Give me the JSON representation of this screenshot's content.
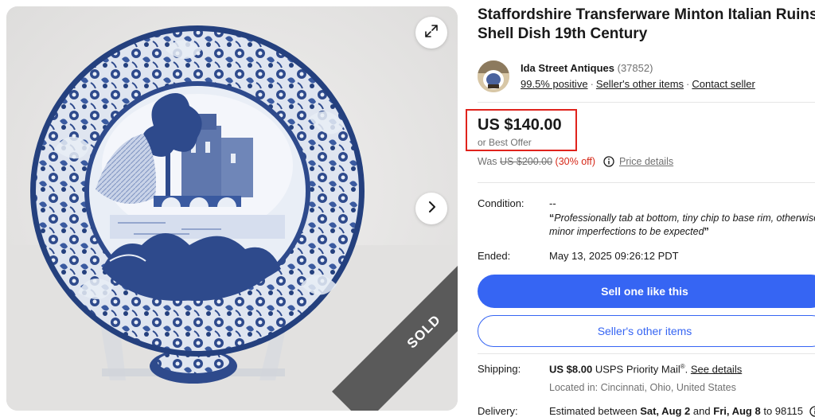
{
  "listing": {
    "title": "Staffordshire Transferware Minton Italian Ruins Shell Dish 19th Century",
    "sold_ribbon": "SOLD"
  },
  "seller": {
    "name": "Ida Street Antiques",
    "feedback_count": "(37852)",
    "positive": "99.5% positive",
    "other_items": "Seller's other items",
    "contact": "Contact seller",
    "separator": "·"
  },
  "price": {
    "amount": "US $140.00",
    "best_offer": "or Best Offer",
    "was_label": "Was",
    "was_amount": "US $200.00",
    "discount": "(30% off)",
    "price_details": "Price details"
  },
  "condition": {
    "label": "Condition:",
    "value": "--",
    "description_line1": "Professionally tab at bottom, tiny chip to base rim, otherwise",
    "description_line2": "minor imperfections to be expected",
    "open_quote": "“",
    "close_quote": "”"
  },
  "ended": {
    "label": "Ended:",
    "value": "May 13, 2025 09:26:12 PDT"
  },
  "buttons": {
    "sell_one": "Sell one like this",
    "sellers_other": "Seller's other items"
  },
  "shipping": {
    "label": "Shipping:",
    "cost": "US $8.00",
    "service": "USPS Priority Mail",
    "reg": "®",
    "see_details": "See details",
    "location": "Located in: Cincinnati, Ohio, United States"
  },
  "delivery": {
    "label": "Delivery:",
    "prefix": "Estimated between",
    "start": "Sat, Aug 2",
    "and": "and",
    "end": "Fri, Aug 8",
    "to": "to 98115"
  },
  "icons": {
    "expand": "expand-icon",
    "next": "chevron-right-icon",
    "info": "info-icon"
  },
  "colors": {
    "primary_blue": "#3665f3",
    "highlight_red": "#e0231c",
    "discount_red": "#d62717",
    "sold_ribbon": "#5a5a5a",
    "plate_blue": "#2e4a8c"
  }
}
